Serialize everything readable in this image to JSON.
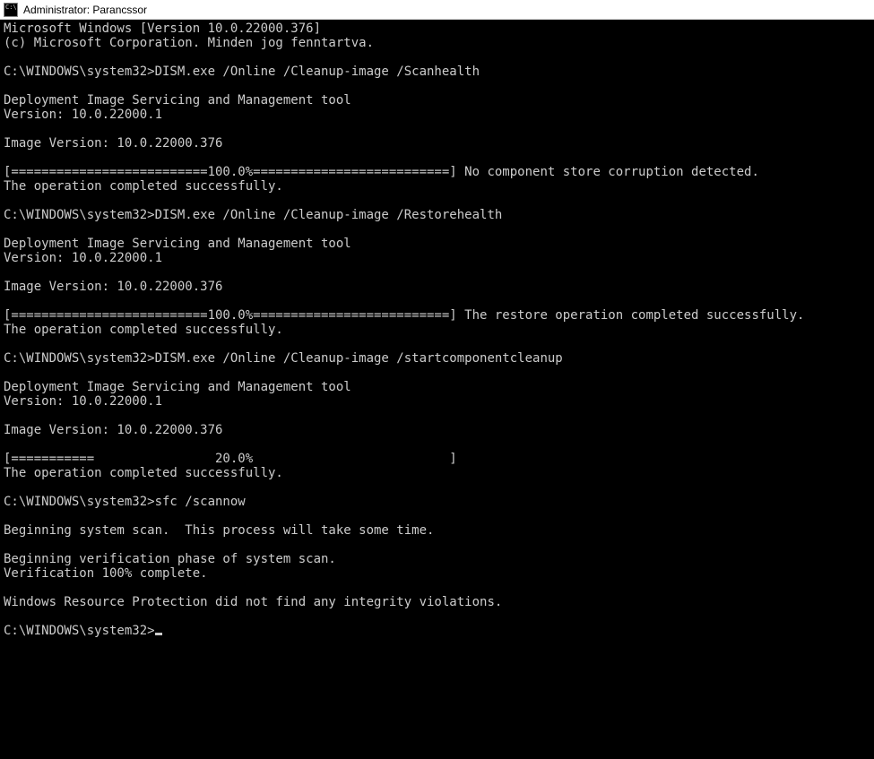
{
  "titlebar": {
    "title": "Administrator: Parancssor"
  },
  "terminal": {
    "lines": [
      "Microsoft Windows [Version 10.0.22000.376]",
      "(c) Microsoft Corporation. Minden jog fenntartva.",
      "",
      "C:\\WINDOWS\\system32>DISM.exe /Online /Cleanup-image /Scanhealth",
      "",
      "Deployment Image Servicing and Management tool",
      "Version: 10.0.22000.1",
      "",
      "Image Version: 10.0.22000.376",
      "",
      "[==========================100.0%==========================] No component store corruption detected.",
      "The operation completed successfully.",
      "",
      "C:\\WINDOWS\\system32>DISM.exe /Online /Cleanup-image /Restorehealth",
      "",
      "Deployment Image Servicing and Management tool",
      "Version: 10.0.22000.1",
      "",
      "Image Version: 10.0.22000.376",
      "",
      "[==========================100.0%==========================] The restore operation completed successfully.",
      "The operation completed successfully.",
      "",
      "C:\\WINDOWS\\system32>DISM.exe /Online /Cleanup-image /startcomponentcleanup",
      "",
      "Deployment Image Servicing and Management tool",
      "Version: 10.0.22000.1",
      "",
      "Image Version: 10.0.22000.376",
      "",
      "[===========                20.0%                          ]",
      "The operation completed successfully.",
      "",
      "C:\\WINDOWS\\system32>sfc /scannow",
      "",
      "Beginning system scan.  This process will take some time.",
      "",
      "Beginning verification phase of system scan.",
      "Verification 100% complete.",
      "",
      "Windows Resource Protection did not find any integrity violations.",
      ""
    ],
    "prompt": "C:\\WINDOWS\\system32>"
  }
}
